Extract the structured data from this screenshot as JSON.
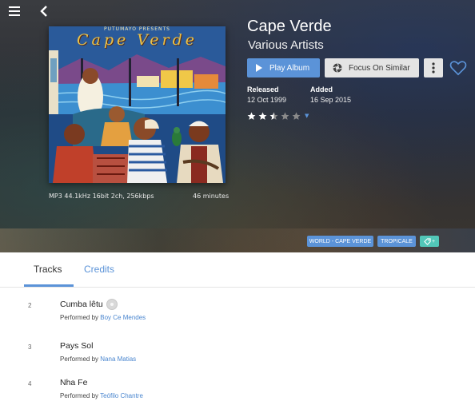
{
  "album": {
    "title": "Cape Verde",
    "artist": "Various Artists",
    "cover_heading": "Cape Verde",
    "cover_subheading": "PUTUMAYO PRESENTS",
    "format": "MP3 44.1kHz 16bit 2ch, 256kbps",
    "duration": "46 minutes",
    "released_label": "Released",
    "released_value": "12 Oct 1999",
    "added_label": "Added",
    "added_value": "16 Sep 2015",
    "rating": 2.5,
    "rating_max": 5
  },
  "actions": {
    "play_label": "Play Album",
    "focus_label": "Focus On Similar"
  },
  "tags": [
    "WORLD - CAPE VERDE",
    "TROPICALE"
  ],
  "tag_add_label": "+",
  "tabs": [
    {
      "label": "Tracks",
      "active": true
    },
    {
      "label": "Credits",
      "active": false
    }
  ],
  "performed_by_label": "Performed by",
  "tracks": [
    {
      "number": "2",
      "title": "Cumba lêtu",
      "artist": "Boy Ce Mendes"
    },
    {
      "number": "3",
      "title": "Pays Sol",
      "artist": "Nana Matias"
    },
    {
      "number": "4",
      "title": "Nha Fe",
      "artist": "Teófilo Chantre"
    }
  ],
  "colors": {
    "accent": "#5b93d8",
    "tag_green": "#52c7b8",
    "star_filled": "#ffffff",
    "star_empty": "#8a8a8a"
  },
  "icons": {
    "menu": "hamburger-menu-icon",
    "back": "chevron-left-icon",
    "play": "play-icon",
    "focus": "aperture-icon",
    "more": "vertical-dots-icon",
    "favorite": "heart-outline-icon",
    "tag": "tag-icon"
  }
}
